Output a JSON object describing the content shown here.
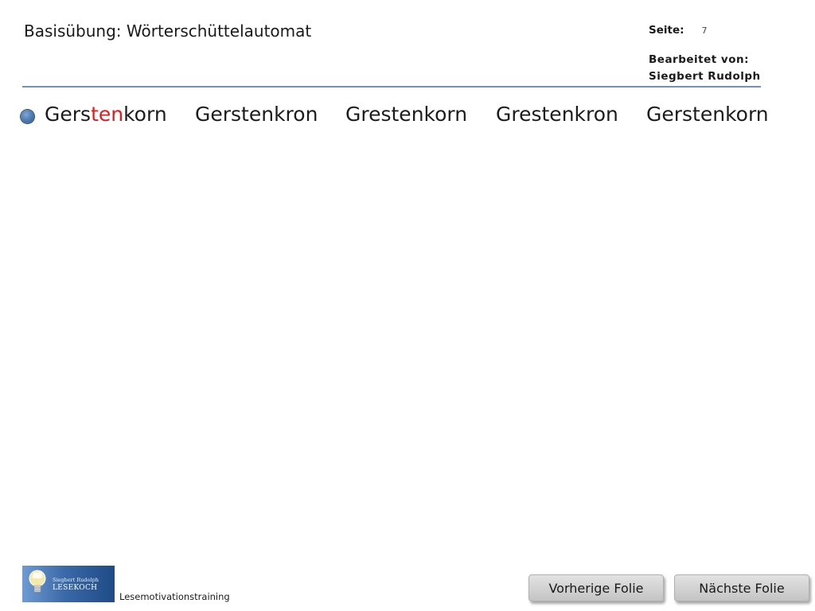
{
  "header": {
    "title": "Basisübung: Wörterschüttelautomat",
    "page_label": "Seite:",
    "page_number": "7",
    "edited_by_label": "Bearbeitet  von:",
    "edited_by_name": "Siegbert  Rudolph"
  },
  "exercise": {
    "words": [
      {
        "pre": "Gers",
        "highlight": "ten",
        "post": "korn"
      },
      {
        "pre": "Gerstenkron",
        "highlight": "",
        "post": ""
      },
      {
        "pre": "Grestenkorn",
        "highlight": "",
        "post": ""
      },
      {
        "pre": "Grestenkron",
        "highlight": "",
        "post": ""
      },
      {
        "pre": "Gerstenkorn",
        "highlight": "",
        "post": ""
      }
    ],
    "highlight_color": "#e11b1b"
  },
  "footer": {
    "logo_line1": "Siegbert Rudolph",
    "logo_line2": "LESEKOCH",
    "course": "Lesemotivationstraining",
    "prev_button": "Vorherige Folie",
    "next_button": "Nächste Folie"
  },
  "colors": {
    "rule": "#6f93b8",
    "bullet": "#4b77ad"
  }
}
